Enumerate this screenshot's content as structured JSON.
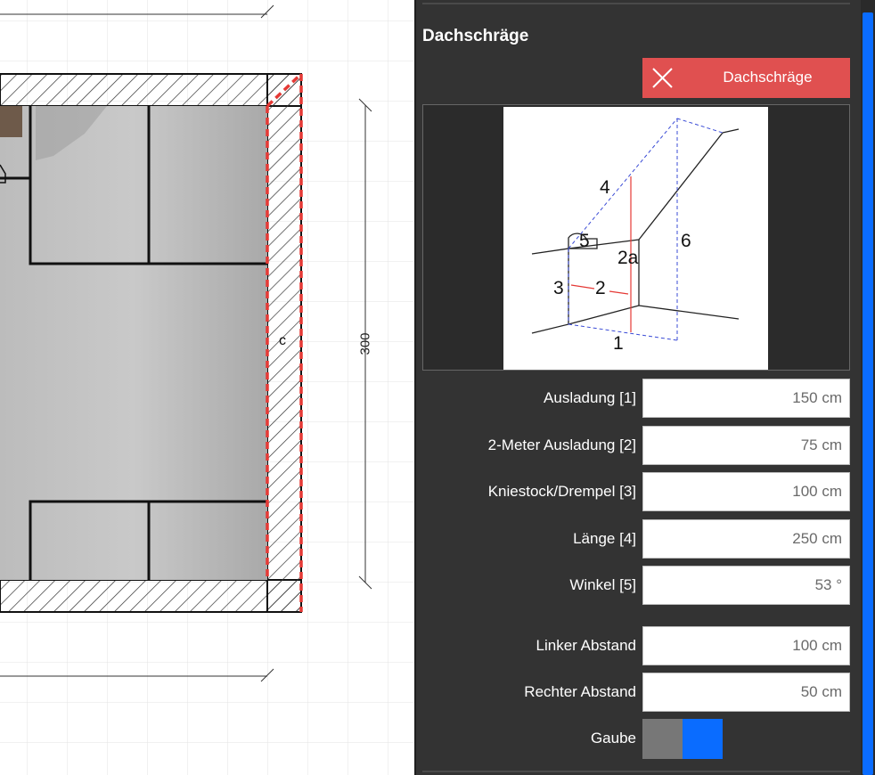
{
  "canvas": {
    "wall_label": "c",
    "dimension_label": "300"
  },
  "panel": {
    "title": "Dachschräge",
    "remove_button_label": "Dachschräge",
    "remove_button_icon": "close-icon",
    "diagram_labels": {
      "l1": "1",
      "l2": "2",
      "l2a": "2a",
      "l3": "3",
      "l4": "4",
      "l5": "5",
      "l6": "6"
    },
    "fields": [
      {
        "label": "Ausladung [1]",
        "value": "150 cm"
      },
      {
        "label": "2-Meter Ausladung [2]",
        "value": "75 cm"
      },
      {
        "label": "Kniestock/Drempel [3]",
        "value": "100 cm"
      },
      {
        "label": "Länge [4]",
        "value": "250 cm"
      },
      {
        "label": "Winkel [5]",
        "value": "53 °"
      },
      {
        "label": "Linker Abstand",
        "value": "100 cm"
      },
      {
        "label": "Rechter Abstand",
        "value": "50 cm"
      }
    ],
    "gaube": {
      "label": "Gaube",
      "enabled": true
    }
  },
  "colors": {
    "panel_bg": "#333333",
    "accent_blue": "#0a6cff",
    "remove_red": "#e05050",
    "wall_highlight": "#e53935"
  }
}
